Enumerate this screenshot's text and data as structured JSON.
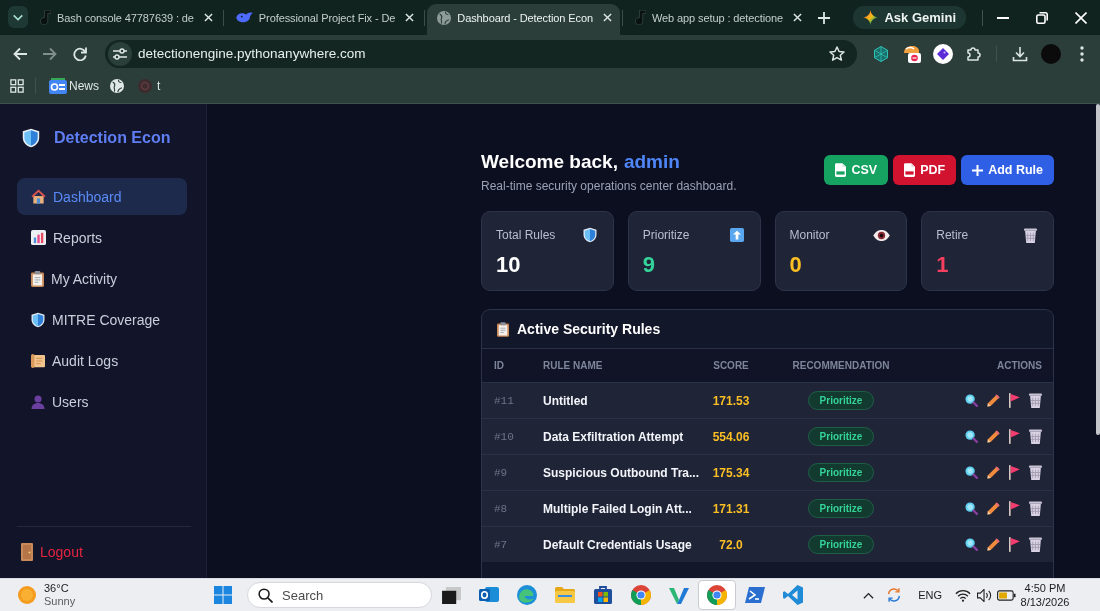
{
  "browser": {
    "tabs": [
      {
        "kind": "note",
        "title": "Bash console 47787639 : de",
        "selected": false
      },
      {
        "kind": "whale",
        "title": "Professional Project Fix - De",
        "selected": false
      },
      {
        "kind": "globe",
        "title": "Dashboard - Detection Econ",
        "selected": true
      },
      {
        "kind": "note",
        "title": "Web app setup : detectione",
        "selected": false
      }
    ],
    "assistant_button": "Ask Gemini",
    "address": "detectionengine.pythonanywhere.com",
    "bookmarks": [
      {
        "kind": "news",
        "label": "News"
      },
      {
        "kind": "globe"
      },
      {
        "kind": "site",
        "label": "t"
      }
    ]
  },
  "sidebar": {
    "brand": "Detection Econ",
    "nav": [
      {
        "kind": "house",
        "label": "Dashboard",
        "selected": true
      },
      {
        "kind": "chart",
        "label": "Reports",
        "selected": false
      },
      {
        "kind": "clipboard",
        "label": "My Activity",
        "selected": false
      },
      {
        "kind": "shield",
        "label": "MITRE Coverage",
        "selected": false
      },
      {
        "kind": "scroll",
        "label": "Audit Logs",
        "selected": false
      },
      {
        "kind": "person",
        "label": "Users",
        "selected": false
      }
    ],
    "logout": "Logout"
  },
  "header": {
    "greeting": "Welcome back,",
    "user": "admin",
    "subtitle": "Real-time security operations center dashboard.",
    "buttons": [
      {
        "kind": "csv",
        "label": "CSV"
      },
      {
        "kind": "pdf",
        "label": "PDF"
      },
      {
        "kind": "add",
        "label": "Add Rule"
      }
    ]
  },
  "stats": [
    {
      "kind": "shield",
      "label": "Total Rules",
      "value": "10",
      "color": "#ffffff"
    },
    {
      "kind": "up",
      "label": "Prioritize",
      "value": "9",
      "color": "#34d399"
    },
    {
      "kind": "eye",
      "label": "Monitor",
      "value": "0",
      "color": "#fbbf24"
    },
    {
      "kind": "trash",
      "label": "Retire",
      "value": "1",
      "color": "#f43f5e"
    }
  ],
  "rules": {
    "title": "Active Security Rules",
    "columns": [
      "ID",
      "RULE NAME",
      "SCORE",
      "RECOMMENDATION",
      "ACTIONS"
    ],
    "rows": [
      {
        "id": "#11",
        "name": "Untitled",
        "score": "171.53",
        "recommendation": "Prioritize"
      },
      {
        "id": "#10",
        "name": "Data Exfiltration Attempt",
        "score": "554.06",
        "recommendation": "Prioritize"
      },
      {
        "id": "#9",
        "name": "Suspicious Outbound Tra...",
        "score": "175.34",
        "recommendation": "Prioritize"
      },
      {
        "id": "#8",
        "name": "Multiple Failed Login Att...",
        "score": "171.31",
        "recommendation": "Prioritize"
      },
      {
        "id": "#7",
        "name": "Default Credentials Usage",
        "score": "72.0",
        "recommendation": "Prioritize"
      }
    ]
  },
  "taskbar": {
    "weather": {
      "temperature": "36°C",
      "condition": "Sunny"
    },
    "search": {
      "placeholder": "Search"
    },
    "apps": [
      {
        "kind": "terminal",
        "selected": false
      },
      {
        "kind": "outlook",
        "selected": false
      },
      {
        "kind": "edge",
        "selected": false
      },
      {
        "kind": "folder",
        "selected": false
      },
      {
        "kind": "store",
        "selected": false
      },
      {
        "kind": "chrome",
        "selected": false
      },
      {
        "kind": "zigzag",
        "selected": false
      },
      {
        "kind": "chrome",
        "selected": true
      },
      {
        "kind": "powershell",
        "selected": false
      },
      {
        "kind": "vscode",
        "selected": false
      }
    ],
    "language": "ENG",
    "time": "4:50 PM",
    "date": "8/13/2026"
  }
}
